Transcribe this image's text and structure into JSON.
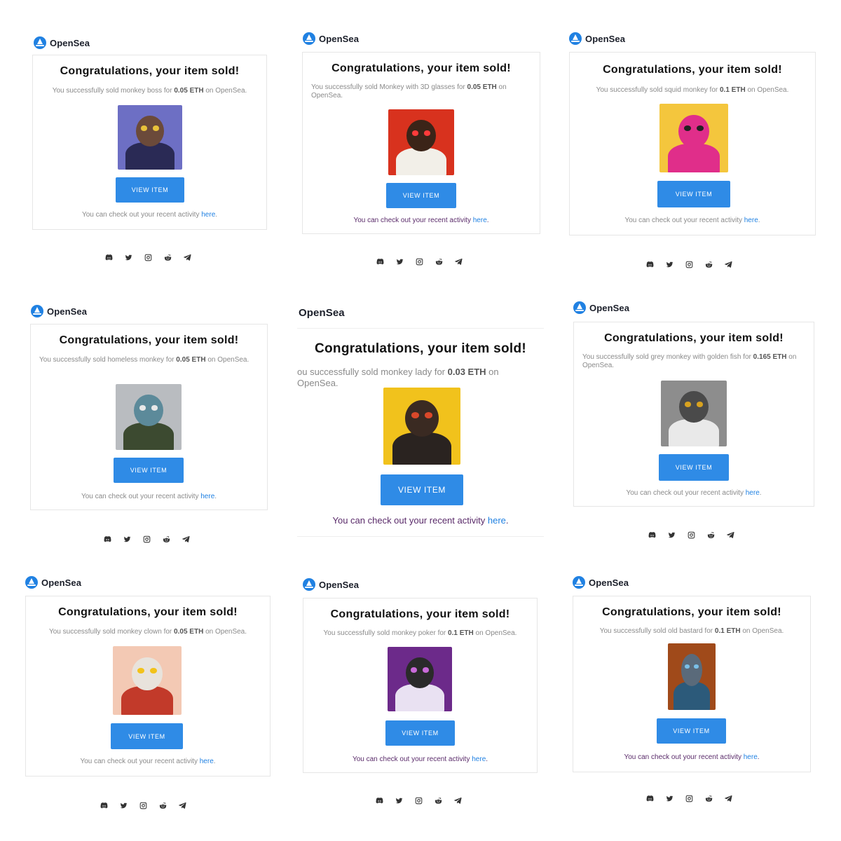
{
  "brand": "OpenSea",
  "title": "Congratulations, your item sold!",
  "button_label": "VIEW ITEM",
  "footer_text": "You can check out your recent activity ",
  "footer_link": "here",
  "desc_prefix": "You successfully sold ",
  "desc_for": " for ",
  "desc_suffix": " on OpenSea.",
  "tile6_desc_prefix": "ou successfully sold ",
  "socials": [
    "discord-icon",
    "twitter-icon",
    "instagram-icon",
    "reddit-icon",
    "telegram-icon"
  ],
  "sales": [
    {
      "item": "monkey boss",
      "price": "0.05 ETH",
      "art": {
        "bg": "#6d6fc4",
        "fur": "#6b4a3a",
        "cloth": "#2a2a55",
        "accent": "#e8c23a"
      }
    },
    {
      "item": "Monkey with 3D glasses",
      "price": "0.05 ETH",
      "art": {
        "bg": "#d8321e",
        "fur": "#3b2418",
        "cloth": "#f2efe8",
        "accent": "#ff3b3b"
      }
    },
    {
      "item": "squid monkey",
      "price": "0.1 ETH",
      "art": {
        "bg": "#f4c63d",
        "fur": "#e02e8a",
        "cloth": "#e02e8a",
        "accent": "#222222"
      }
    },
    {
      "item": "homeless monkey",
      "price": "0.05 ETH",
      "art": {
        "bg": "#b9bcc0",
        "fur": "#5c8a9a",
        "cloth": "#3c4a30",
        "accent": "#e8e8e8"
      }
    },
    {
      "item": "monkey lady",
      "price": "0.03 ETH",
      "art": {
        "bg": "#f1c21c",
        "fur": "#3a2a22",
        "cloth": "#2a2320",
        "accent": "#d9482a"
      }
    },
    {
      "item": "grey monkey with golden fish",
      "price": "0.165 ETH",
      "art": {
        "bg": "#8d8d8d",
        "fur": "#4a4a4a",
        "cloth": "#e9e9e9",
        "accent": "#d8a21f"
      }
    },
    {
      "item": "monkey clown",
      "price": "0.05 ETH",
      "art": {
        "bg": "#f3c9b4",
        "fur": "#e8e3dc",
        "cloth": "#c23a2a",
        "accent": "#f2c21a"
      }
    },
    {
      "item": "monkey poker",
      "price": "0.1 ETH",
      "art": {
        "bg": "#6c2a8a",
        "fur": "#2a2a2a",
        "cloth": "#e9e1f2",
        "accent": "#c86ad8"
      }
    },
    {
      "item": "old bastard",
      "price": "0.1 ETH",
      "art": {
        "bg": "#a04a1a",
        "fur": "#5a6a7a",
        "cloth": "#2c5a7a",
        "accent": "#7ac0e8"
      }
    }
  ]
}
